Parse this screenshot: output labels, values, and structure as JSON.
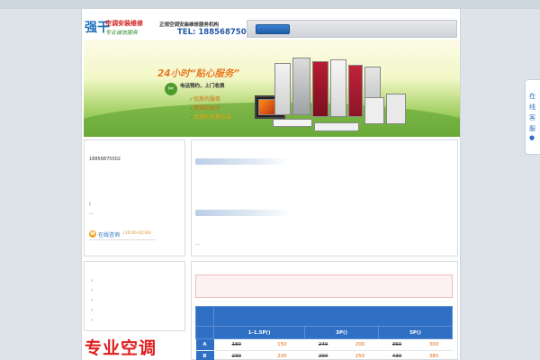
{
  "header": {
    "logo_mark": "强干",
    "logo_line1": "空调安装维修",
    "logo_line2": "专业诚信服务",
    "slogan": "正规空调安装维修服务机构",
    "tel": "TEL: 18856875002"
  },
  "banner": {
    "title": "24小时“贴心服务”",
    "subtitle": "电话预约，上门收费",
    "features": [
      "优质的服务",
      "精湛的技术",
      "合理的收费标准"
    ]
  },
  "contact": {
    "phone": "18856875002",
    "note": "(",
    "ellipsis": "...",
    "online_label": "在线咨询",
    "online_hours": "(10:00-22:00)"
  },
  "news": {
    "ellipsis": "..."
  },
  "side_list": {
    "items": [
      "›",
      "›",
      "›",
      "›",
      "›"
    ]
  },
  "promo": {
    "text": "专业空调"
  },
  "price_table": {
    "headers": [
      "",
      "1-1.5P()",
      "3P()",
      "5P()"
    ],
    "rows": [
      {
        "key": "A",
        "p1_old": "180",
        "p1_new": "150",
        "p3_old": "240",
        "p3_new": "200",
        "p5_old": "360",
        "p5_new": "300"
      },
      {
        "key": "B",
        "p1_old": "230",
        "p1_new": "200",
        "p3_old": "290",
        "p3_new": "250",
        "p5_old": "430",
        "p5_new": "380"
      }
    ]
  },
  "sidetab": {
    "label": "在线客服",
    "icon": "chat-icon"
  },
  "colors": {
    "accent_blue": "#2f6fc4",
    "accent_orange": "#e46a12",
    "promo_red": "#e01e1e"
  }
}
